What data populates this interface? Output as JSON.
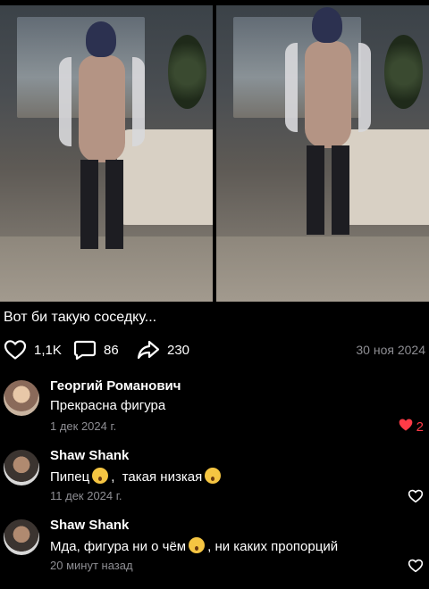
{
  "post": {
    "caption": "Вот би такую соседку...",
    "likes": "1,1K",
    "comments": "86",
    "reposts": "230",
    "date": "30 ноя 2024"
  },
  "comments": [
    {
      "author": "Георгий Романович",
      "text": "Прекрасна фигура",
      "date": "1 дек 2024 г.",
      "likes": "2",
      "liked": true
    },
    {
      "author": "Shaw Shank",
      "text_a": "Пипец",
      "text_b": ",  такая низкая",
      "date": "11 дек 2024 г.",
      "liked": false
    },
    {
      "author": "Shaw Shank",
      "text_a": "Мда, фигура ни о чём",
      "text_b": ", ни каких пропорций",
      "date": "20 минут назад",
      "liked": false
    }
  ],
  "colors": {
    "like_red": "#ff3b47",
    "muted": "#8e8e93"
  },
  "icons": [
    "heart-outline-icon",
    "speech-bubble-icon",
    "share-arrow-icon",
    "heart-filled-icon",
    "emoji-hushed-icon",
    "emoji-laughing-icon",
    "emoji-astonished-icon"
  ]
}
